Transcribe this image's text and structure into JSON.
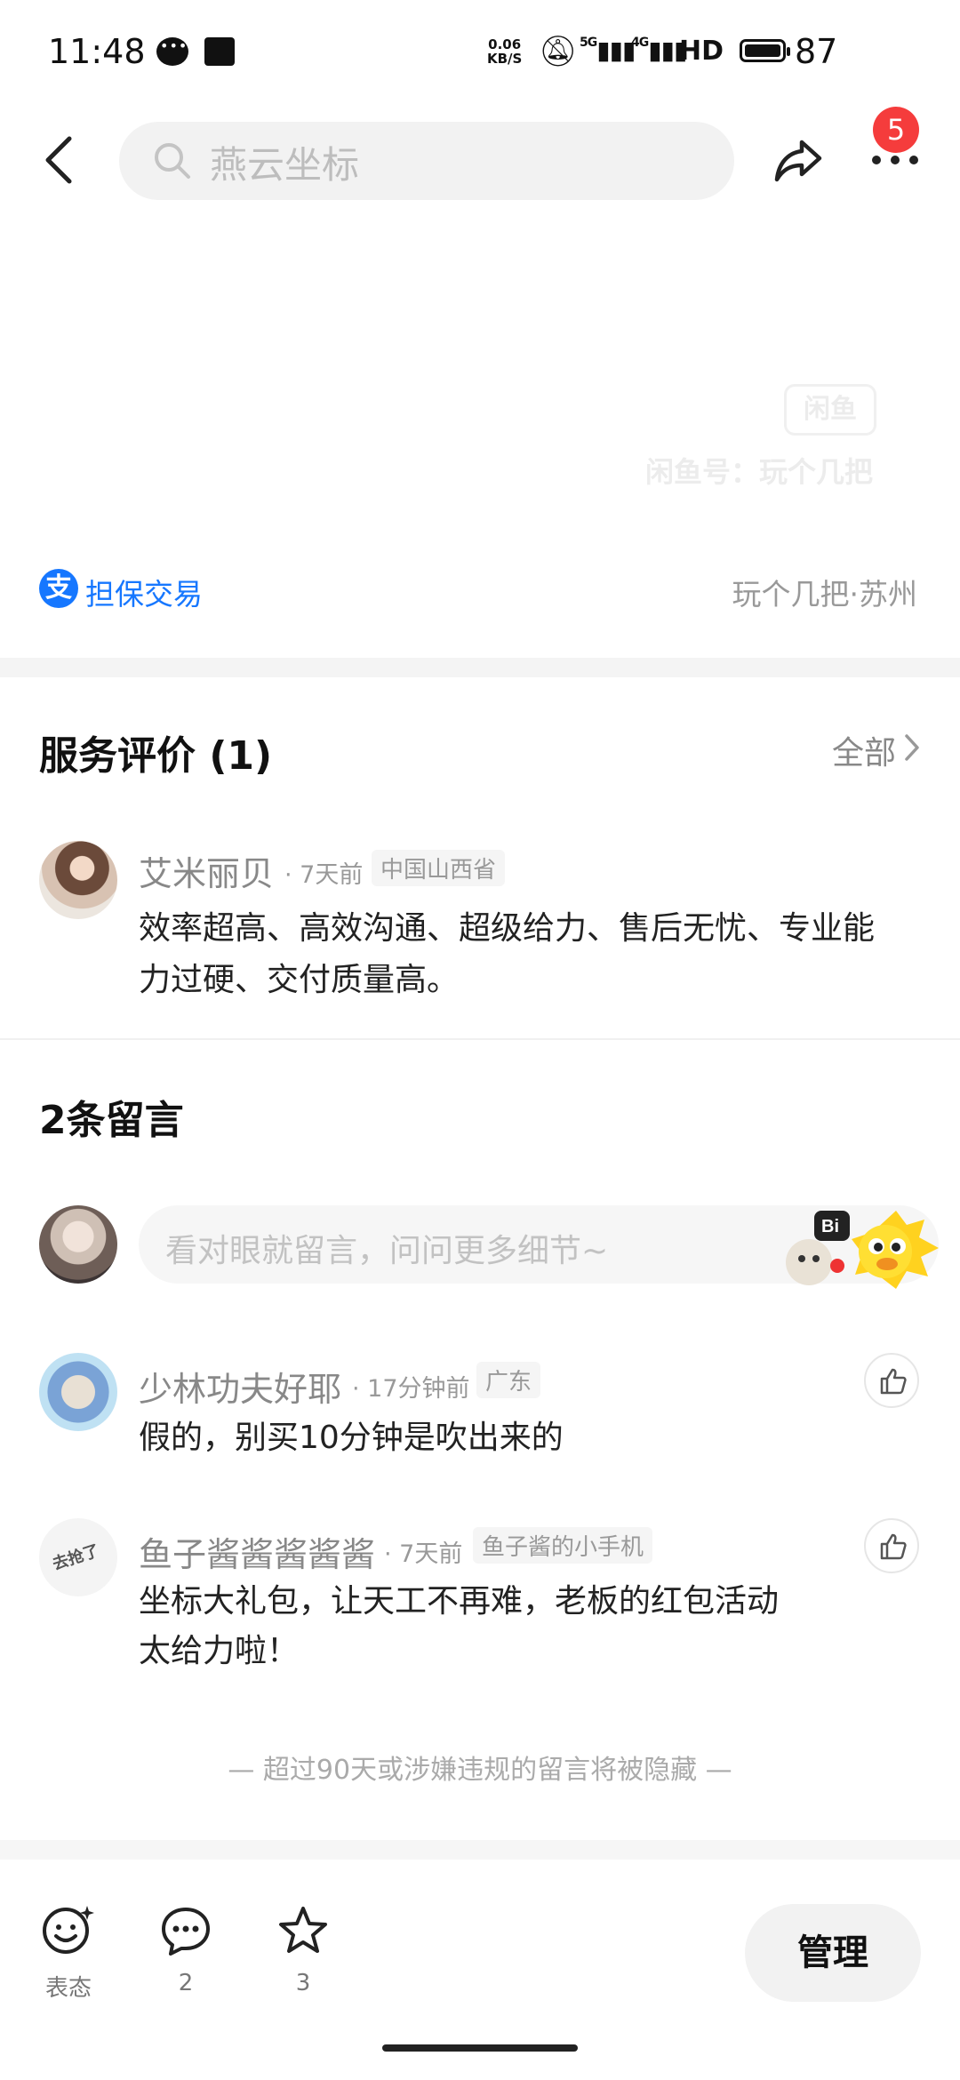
{
  "status_bar": {
    "time": "11:48",
    "net_speed_value": "0.06",
    "net_speed_unit": "KB/S",
    "signal_1": "5G",
    "signal_2": "4G",
    "hd": "HD",
    "battery": "87"
  },
  "header": {
    "search_text": "燕云坐标",
    "badge_count": "5"
  },
  "watermark": {
    "logo": "闲鱼",
    "account": "闲鱼号：玩个几把"
  },
  "trade": {
    "guarantee_label": "担保交易",
    "location": "玩个几把·苏州"
  },
  "reviews": {
    "title": "服务评价 (1)",
    "all_link": "全部",
    "items": [
      {
        "name": "艾米丽贝",
        "time": "· 7天前",
        "tag": "中国山西省",
        "text": "效率超高、高效沟通、超级给力、售后无忧、专业能力过硬、交付质量高。"
      }
    ]
  },
  "comments": {
    "title": "2条留言",
    "input_placeholder": "看对眼就留言，问问更多细节~",
    "items": [
      {
        "name": "少林功夫好耶",
        "time": "· 17分钟前",
        "tag": "广东",
        "text": "假的，别买10分钟是吹出来的"
      },
      {
        "name": "鱼子酱酱酱酱酱",
        "time": "· 7天前",
        "tag": "鱼子酱的小手机",
        "text": "坐标大礼包，让天工不再难，老板的红包活动太给力啦！",
        "avatar_text": "去抢了"
      }
    ],
    "hidden_note": "— 超过90天或涉嫌违规的留言将被隐藏 —"
  },
  "bottom_bar": {
    "emote_label": "表态",
    "comment_count": "2",
    "favorite_count": "3",
    "manage_label": "管理"
  },
  "colors": {
    "accent_blue": "#1677ff",
    "badge_red": "#f53c3c"
  }
}
